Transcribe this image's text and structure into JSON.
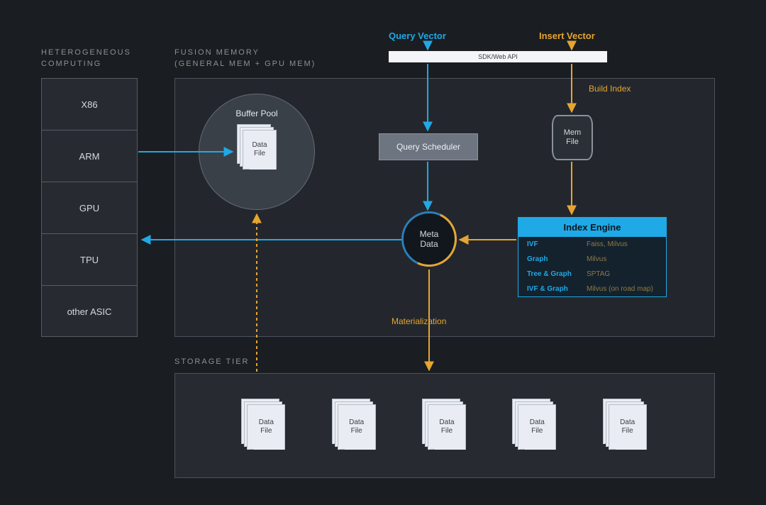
{
  "sections": {
    "heterogeneous_title1": "HETEROGENEOUS",
    "heterogeneous_title2": "COMPUTING",
    "fusion_title1": "FUSION MEMORY",
    "fusion_title2": "(GENERAL MEM + GPU MEM)",
    "storage_title": "STORAGE TIER"
  },
  "hc_items": [
    "X86",
    "ARM",
    "GPU",
    "TPU",
    "other ASIC"
  ],
  "buffer_pool": {
    "label": "Buffer Pool",
    "file_l1": "Data",
    "file_l2": "File"
  },
  "sdk_bar": "SDK/Web API",
  "top_labels": {
    "query_vector": "Query Vector",
    "insert_vector": "Insert Vector",
    "build_index": "Build Index",
    "materialization": "Materialization"
  },
  "query_scheduler": "Query Scheduler",
  "mem_file": {
    "l1": "Mem",
    "l2": "File"
  },
  "meta_data": {
    "l1": "Meta",
    "l2": "Data"
  },
  "index_engine": {
    "title": "Index Engine",
    "rows": [
      {
        "key": "IVF",
        "val": "Faiss, Milvus"
      },
      {
        "key": "Graph",
        "val": "Milvus"
      },
      {
        "key": "Tree & Graph",
        "val": "SPTAG"
      },
      {
        "key": "IVF & Graph",
        "val": "Milvus (on road map)"
      }
    ]
  },
  "storage_files": [
    {
      "l1": "Data",
      "l2": "File"
    },
    {
      "l1": "Data",
      "l2": "File"
    },
    {
      "l1": "Data",
      "l2": "File"
    },
    {
      "l1": "Data",
      "l2": "File"
    },
    {
      "l1": "Data",
      "l2": "File"
    }
  ],
  "colors": {
    "blue": "#1fa9e6",
    "orange": "#e6a530",
    "gray": "#8a9199"
  }
}
